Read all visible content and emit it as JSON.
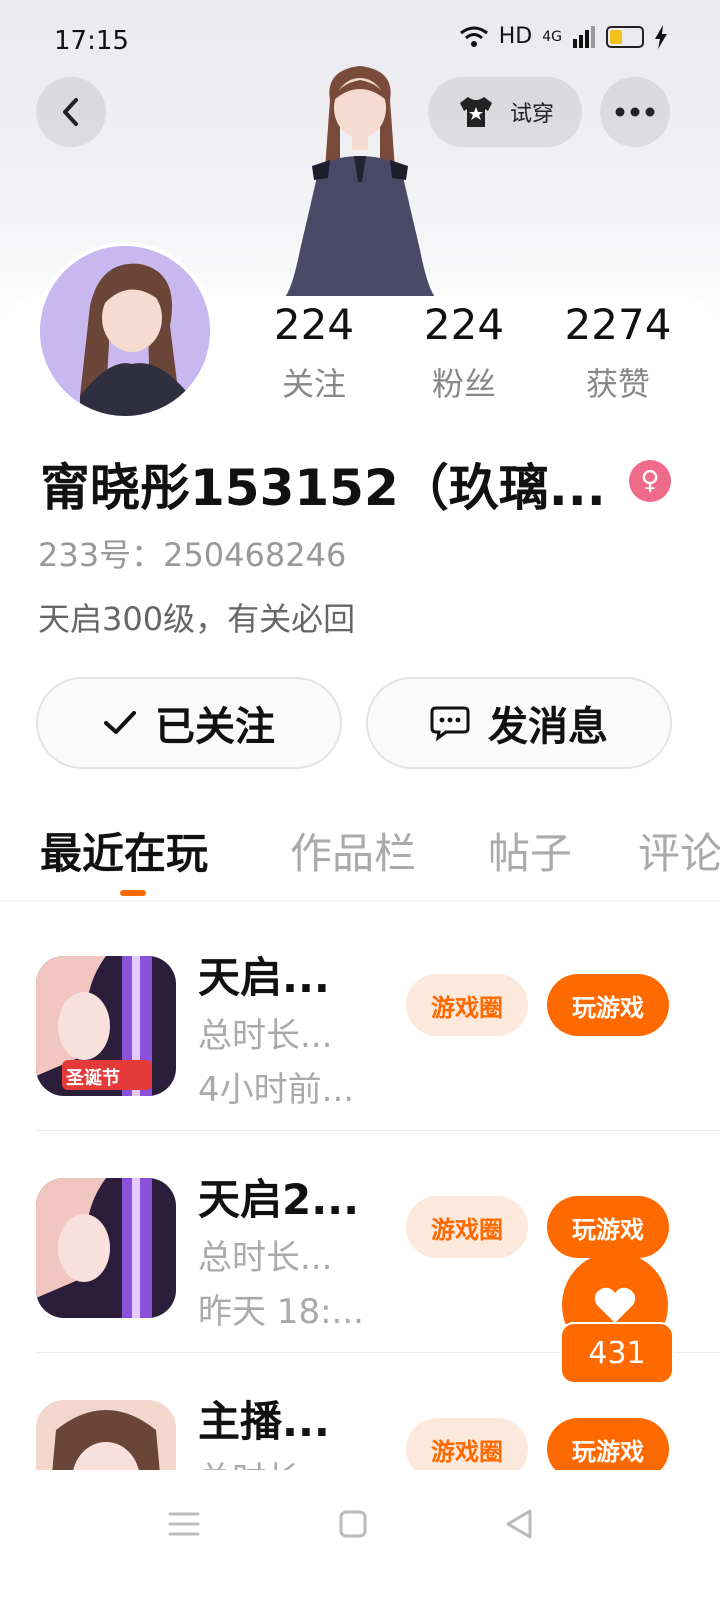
{
  "status_bar": {
    "time": "17:15",
    "network": "HD",
    "cell": "4G"
  },
  "header": {
    "try_on_label": "试穿"
  },
  "profile": {
    "stats": [
      {
        "value": "224",
        "label": "关注"
      },
      {
        "value": "224",
        "label": "粉丝"
      },
      {
        "value": "2274",
        "label": "获赞"
      }
    ],
    "name": "甯晓彤153152（玖璃...",
    "uid": "233号：250468246",
    "bio": "天启300级，有关必回",
    "follow_button": "已关注",
    "message_button": "发消息"
  },
  "tabs": [
    {
      "label": "最近在玩"
    },
    {
      "label": "作品栏"
    },
    {
      "label": "帖子"
    },
    {
      "label": "评论"
    }
  ],
  "games": [
    {
      "title": "天启...",
      "time_total": "总时长...",
      "last_played": "4小时前...",
      "circle_label": "游戏圈",
      "play_label": "玩游戏",
      "badge": "圣诞节"
    },
    {
      "title": "天启2...",
      "time_total": "总时长...",
      "last_played": "昨天 18:...",
      "circle_label": "游戏圈",
      "play_label": "玩游戏"
    },
    {
      "title": "主播...",
      "time_total": "总时长",
      "last_played": "",
      "circle_label": "游戏圈",
      "play_label": "玩游戏"
    }
  ],
  "like_count": "431",
  "colors": {
    "accent": "#ff6a00",
    "accent_light": "#fde8dc",
    "gender": "#f06b8a"
  }
}
